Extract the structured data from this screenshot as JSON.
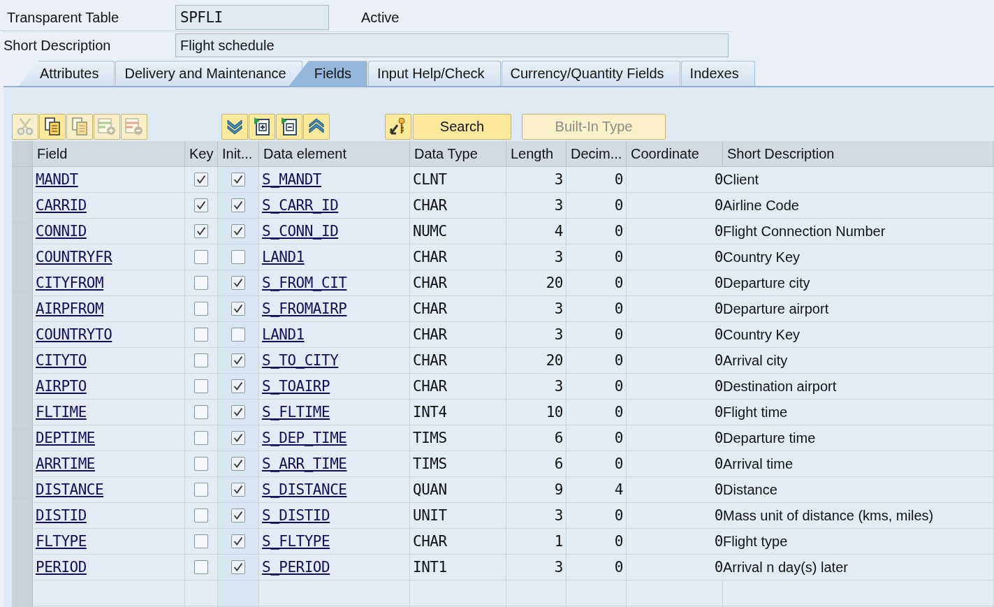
{
  "header": {
    "object_type": "Transparent Table",
    "table_name": "SPFLI",
    "status": "Active",
    "description_label": "Short Description",
    "description": "Flight schedule"
  },
  "tabs": [
    {
      "label": "Attributes",
      "selected": false
    },
    {
      "label": "Delivery and Maintenance",
      "selected": false
    },
    {
      "label": "Fields",
      "selected": true
    },
    {
      "label": "Input Help/Check",
      "selected": false
    },
    {
      "label": "Currency/Quantity Fields",
      "selected": false
    },
    {
      "label": "Indexes",
      "selected": false
    }
  ],
  "toolbar": {
    "icon_buttons": [
      {
        "disabled": true
      },
      {
        "disabled": false
      },
      {
        "disabled": true
      },
      {
        "disabled": true
      },
      {
        "disabled": true
      },
      {
        "disabled": false
      },
      {
        "disabled": false
      },
      {
        "disabled": false
      },
      {
        "disabled": false
      },
      {
        "disabled": false
      }
    ],
    "buttons": [
      {
        "label": "Search",
        "disabled": false
      },
      {
        "label": "Built-In Type",
        "disabled": true
      }
    ]
  },
  "table": {
    "columns": [
      "Field",
      "Key",
      "Init...",
      "Data element",
      "Data Type",
      "Length",
      "Decim...",
      "Coordinate",
      "Short Description"
    ],
    "rows": [
      {
        "field": "MANDT",
        "key": true,
        "initial": true,
        "data_element": "S_MANDT",
        "data_type": "CLNT",
        "length": "3",
        "decimals": "0",
        "coordinate": "0",
        "description": "Client"
      },
      {
        "field": "CARRID",
        "key": true,
        "initial": true,
        "data_element": "S_CARR_ID",
        "data_type": "CHAR",
        "length": "3",
        "decimals": "0",
        "coordinate": "0",
        "description": "Airline Code"
      },
      {
        "field": "CONNID",
        "key": true,
        "initial": true,
        "data_element": "S_CONN_ID",
        "data_type": "NUMC",
        "length": "4",
        "decimals": "0",
        "coordinate": "0",
        "description": "Flight Connection Number"
      },
      {
        "field": "COUNTRYFR",
        "key": false,
        "initial": false,
        "data_element": "LAND1",
        "data_type": "CHAR",
        "length": "3",
        "decimals": "0",
        "coordinate": "0",
        "description": "Country Key"
      },
      {
        "field": "CITYFROM",
        "key": false,
        "initial": true,
        "data_element": "S_FROM_CIT",
        "data_type": "CHAR",
        "length": "20",
        "decimals": "0",
        "coordinate": "0",
        "description": "Departure city"
      },
      {
        "field": "AIRPFROM",
        "key": false,
        "initial": true,
        "data_element": "S_FROMAIRP",
        "data_type": "CHAR",
        "length": "3",
        "decimals": "0",
        "coordinate": "0",
        "description": "Departure airport"
      },
      {
        "field": "COUNTRYTO",
        "key": false,
        "initial": false,
        "data_element": "LAND1",
        "data_type": "CHAR",
        "length": "3",
        "decimals": "0",
        "coordinate": "0",
        "description": "Country Key"
      },
      {
        "field": "CITYTO",
        "key": false,
        "initial": true,
        "data_element": "S_TO_CITY",
        "data_type": "CHAR",
        "length": "20",
        "decimals": "0",
        "coordinate": "0",
        "description": "Arrival city"
      },
      {
        "field": "AIRPTO",
        "key": false,
        "initial": true,
        "data_element": "S_TOAIRP",
        "data_type": "CHAR",
        "length": "3",
        "decimals": "0",
        "coordinate": "0",
        "description": "Destination airport"
      },
      {
        "field": "FLTIME",
        "key": false,
        "initial": true,
        "data_element": "S_FLTIME",
        "data_type": "INT4",
        "length": "10",
        "decimals": "0",
        "coordinate": "0",
        "description": "Flight time"
      },
      {
        "field": "DEPTIME",
        "key": false,
        "initial": true,
        "data_element": "S_DEP_TIME",
        "data_type": "TIMS",
        "length": "6",
        "decimals": "0",
        "coordinate": "0",
        "description": "Departure time"
      },
      {
        "field": "ARRTIME",
        "key": false,
        "initial": true,
        "data_element": "S_ARR_TIME",
        "data_type": "TIMS",
        "length": "6",
        "decimals": "0",
        "coordinate": "0",
        "description": "Arrival time"
      },
      {
        "field": "DISTANCE",
        "key": false,
        "initial": true,
        "data_element": "S_DISTANCE",
        "data_type": "QUAN",
        "length": "9",
        "decimals": "4",
        "coordinate": "0",
        "description": "Distance"
      },
      {
        "field": "DISTID",
        "key": false,
        "initial": true,
        "data_element": "S_DISTID",
        "data_type": "UNIT",
        "length": "3",
        "decimals": "0",
        "coordinate": "0",
        "description": "Mass unit of distance (kms, miles)"
      },
      {
        "field": "FLTYPE",
        "key": false,
        "initial": true,
        "data_element": "S_FLTYPE",
        "data_type": "CHAR",
        "length": "1",
        "decimals": "0",
        "coordinate": "0",
        "description": "Flight type"
      },
      {
        "field": "PERIOD",
        "key": false,
        "initial": true,
        "data_element": "S_PERIOD",
        "data_type": "INT1",
        "length": "3",
        "decimals": "0",
        "coordinate": "0",
        "description": "Arrival n day(s) later"
      }
    ]
  }
}
